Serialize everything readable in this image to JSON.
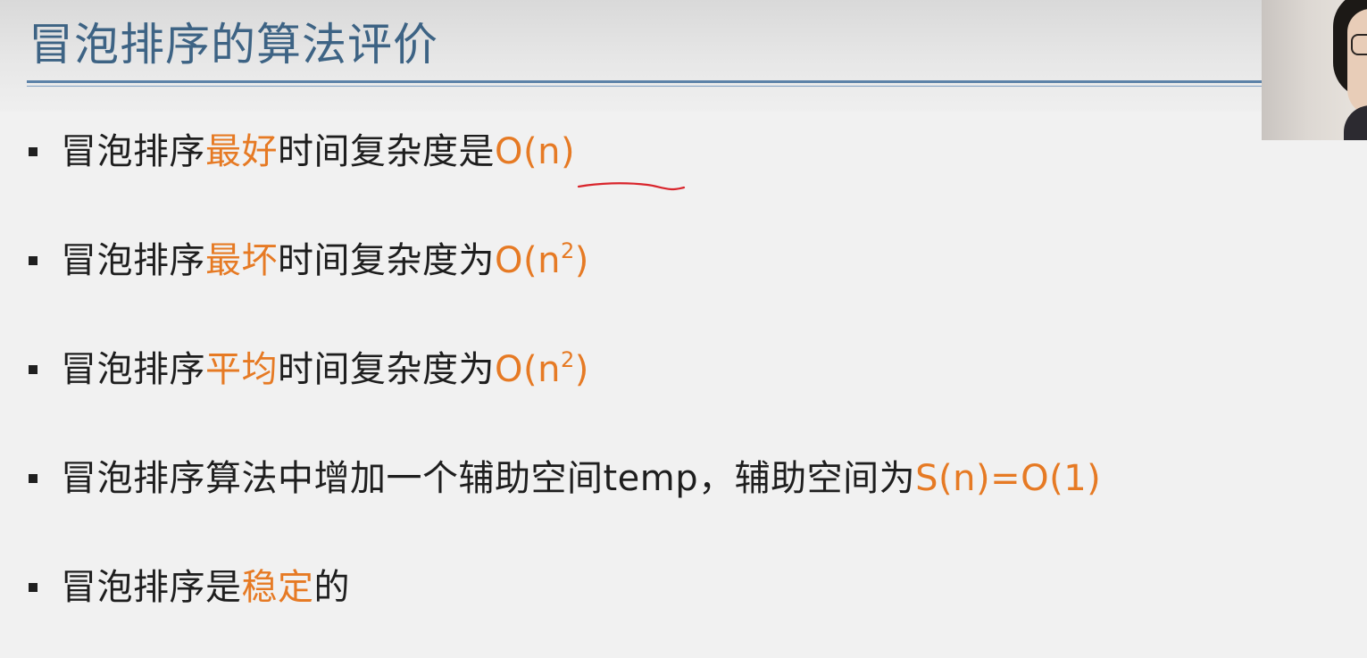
{
  "slide": {
    "title": "冒泡排序的算法评价"
  },
  "bullets": [
    {
      "pre": "冒泡排序",
      "hl1": "最好",
      "mid": "时间复杂度是",
      "hl2": "O(n)",
      "sup": "",
      "post": ""
    },
    {
      "pre": "冒泡排序",
      "hl1": "最坏",
      "mid": "时间复杂度为",
      "hl2": "O(n",
      "sup": "2",
      "post": ")"
    },
    {
      "pre": "冒泡排序",
      "hl1": "平均",
      "mid": "时间复杂度为",
      "hl2": "O(n",
      "sup": "2",
      "post": ")"
    },
    {
      "pre": "冒泡排序算法中增加一个辅助空间temp，辅助空间为",
      "hl2": "S(n)=O(1)"
    },
    {
      "pre": "冒泡排序是",
      "hl1": "稳定",
      "mid": "的"
    }
  ],
  "colors": {
    "title": "#3d6384",
    "highlight": "#e67a24",
    "rule": "#5c82a8",
    "annotation": "#d9252c"
  }
}
